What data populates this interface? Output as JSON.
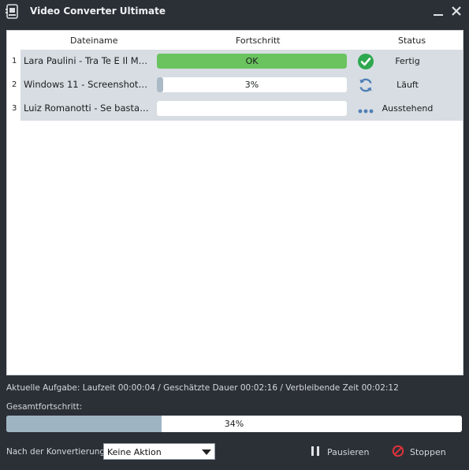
{
  "window": {
    "title": "Video Converter Ultimate"
  },
  "table": {
    "headers": {
      "name": "Dateiname",
      "progress": "Fortschritt",
      "status": "Status"
    },
    "rows": [
      {
        "index": "1",
        "name": "Lara Paulini   - Tra Te E Il Ma...",
        "progress_label": "OK",
        "progress_value": 1.0,
        "status": "Fertig",
        "status_icon": "check-icon"
      },
      {
        "index": "2",
        "name": "Windows 11 - Screenshots ...",
        "progress_label": "3%",
        "progress_value": 0.03,
        "status": "Läuft",
        "status_icon": "refresh-icon"
      },
      {
        "index": "3",
        "name": "Luiz Romanotti - Se bastass...",
        "progress_label": "",
        "progress_value": 0.0,
        "status": "Ausstehend",
        "status_icon": "ellipsis-icon"
      }
    ]
  },
  "current_task": "Aktuelle Aufgabe: Laufzeit 00:00:04 / Geschätzte Dauer 00:02:16 / Verbleibende Zeit 00:02:12",
  "overall": {
    "label": "Gesamtfortschritt:",
    "value_text": "34%",
    "value": 0.34
  },
  "after_conversion": {
    "label": "Nach der Konvertierung:",
    "selected": "Keine Aktion"
  },
  "buttons": {
    "pause": "Pausieren",
    "stop": "Stoppen"
  },
  "colors": {
    "done": "#6ac35f",
    "progress": "#aabac6",
    "stop_red": "#e0323a",
    "status_blue": "#4f7fb5"
  }
}
